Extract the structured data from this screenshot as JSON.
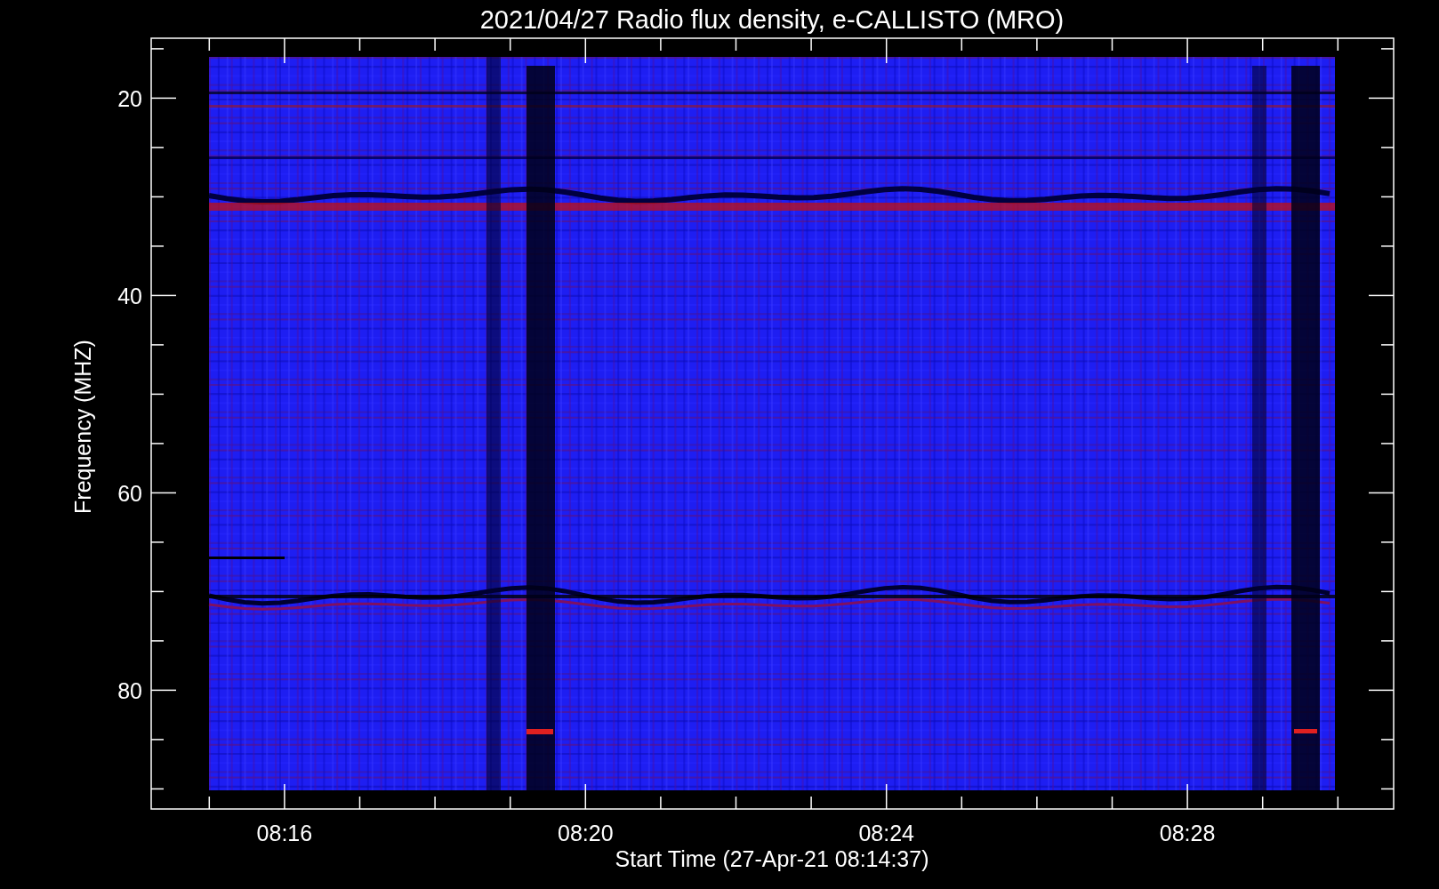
{
  "plot": {
    "title": "2021/04/27  Radio flux density, e-CALLISTO (MRO)",
    "xlabel": "Start Time (27-Apr-21 08:14:37)",
    "ylabel": "Frequency (MHZ)",
    "xticks": [
      "08:16",
      "08:20",
      "08:24",
      "08:28"
    ],
    "yticks": [
      "20",
      "40",
      "60",
      "80"
    ]
  }
}
